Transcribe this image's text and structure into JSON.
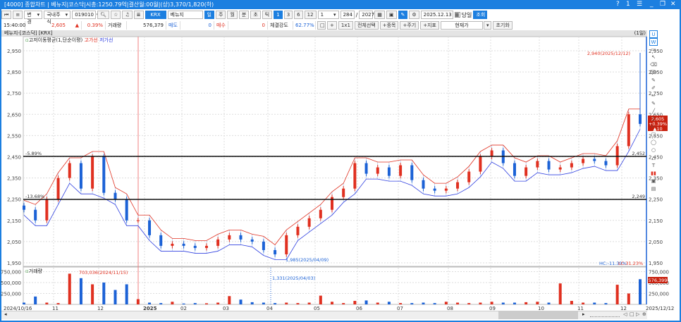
{
  "window": {
    "title": "[4000] 종합차트 | 베뉴지|코스닥|시총:1250.79억|결산월:00월|(상)3,370/1,820(하)",
    "help": "?",
    "one": "1",
    "menu": "☰",
    "min": "_",
    "restore": "❐",
    "close": "✕"
  },
  "toolbar": {
    "change": "변경",
    "market": "국내주식",
    "code": "019010",
    "exchange": "KRX",
    "name": "베뉴지",
    "periods": [
      "일",
      "주",
      "월",
      "분",
      "초",
      "틱"
    ],
    "nums": [
      "1",
      "3",
      "6",
      "12"
    ],
    "interval": "1",
    "count": "284",
    "total": "2027",
    "date": "2025.12.13",
    "today": "당일",
    "query": "조회"
  },
  "info": {
    "time": "15:40:00",
    "price": "2,605",
    "change": "▲ 10",
    "rate": "0.39%",
    "vol_label": "거래량",
    "volume": "576,379",
    "ask_label": "매도",
    "ask": "0",
    "bid_label": "매수",
    "bid": "0",
    "strength_label": "체결강도",
    "strength": "62.77%",
    "plus": "+",
    "ratio": "1x1",
    "select_all": "전체선택",
    "add_item": "+종목",
    "add_period": "+주기",
    "indicator": "+지표",
    "price_type": "현재가",
    "reset": "초기화"
  },
  "chart": {
    "header": "베뉴지-[코스닥] [KRX]",
    "period": "(1일)",
    "legend_title": "고저이동평균(1,단순이평)",
    "legend_high": "고가선",
    "legend_low": "저가선",
    "volume_title": "거래량"
  },
  "colors": {
    "up": "#e03020",
    "down": "#1c62d6",
    "accent": "#1c7fe0"
  },
  "chart_data": {
    "type": "candlestick",
    "price_axis": {
      "min": 1950,
      "max": 2950,
      "ticks": [
        "2,950",
        "2,850",
        "2,750",
        "2,650",
        "2,550",
        "2,450",
        "2,350",
        "2,250",
        "2,150",
        "2,050",
        "1,950"
      ]
    },
    "closes": [
      2200,
      2150,
      2250,
      2350,
      2420,
      2300,
      2450,
      2280,
      2250,
      2150,
      2150,
      2080,
      2030,
      2040,
      2030,
      2020,
      2030,
      2060,
      2080,
      2060,
      2050,
      2010,
      1990,
      2080,
      2120,
      2160,
      2200,
      2260,
      2300,
      2420,
      2370,
      2400,
      2360,
      2410,
      2340,
      2300,
      2290,
      2300,
      2330,
      2380,
      2450,
      2480,
      2420,
      2360,
      2400,
      2430,
      2390,
      2400,
      2420,
      2440,
      2430,
      2410,
      2500,
      2650,
      2605
    ],
    "volumes": [
      40000,
      180000,
      40000,
      30000,
      703036,
      600000,
      460000,
      500000,
      330000,
      460000,
      120000,
      40000,
      30000,
      60000,
      20000,
      30000,
      25000,
      40000,
      190000,
      110000,
      50000,
      40000,
      30000,
      40000,
      30000,
      40000,
      200000,
      60000,
      30000,
      80000,
      90000,
      40000,
      60000,
      30000,
      30000,
      40000,
      30000,
      60000,
      40000,
      30000,
      40000,
      60000,
      40000,
      40000,
      50000,
      60000,
      40000,
      480000,
      80000,
      40000,
      40000,
      30000,
      450000,
      250000,
      576399
    ],
    "volume_axis": {
      "ticks": [
        "750,000",
        "500,000",
        "250,000"
      ]
    },
    "x_labels": [
      "2024/10/16",
      "11",
      "12",
      "2025",
      "02",
      "03",
      "04",
      "05",
      "06",
      "07",
      "08",
      "09",
      "10",
      "11",
      "12",
      "2025/12/12"
    ],
    "hlines": [
      {
        "value": 2452,
        "label": "2,452",
        "pct": "-5.89%"
      },
      {
        "value": 2249,
        "label": "2,249",
        "pct": "-13.68%"
      }
    ],
    "annotations": {
      "high": "2,940(2025/12/12)",
      "low": "1,985(2025/04/09)",
      "vol_high": "703,036(2024/11/15)",
      "vol_low": "1,331(2025/04/03)",
      "hc": "HC:-11.39%",
      "lc": "LC:31.23%"
    },
    "current": {
      "price": "2,605",
      "rate": "+0.39%",
      "change": "▲10",
      "volume": "576,399"
    }
  }
}
